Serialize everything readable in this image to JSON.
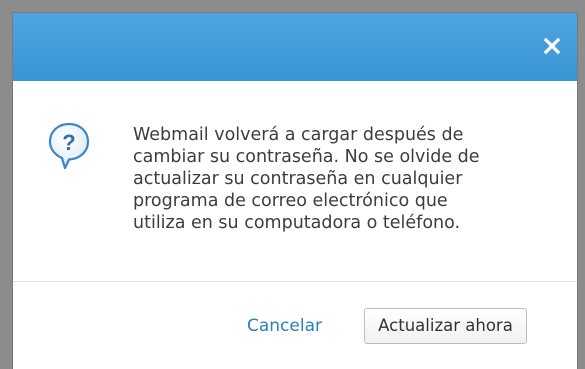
{
  "dialog": {
    "close_glyph": "x",
    "icon": "question-help-icon",
    "message_lines": [
      "Webmail volverá a cargar después de",
      "cambiar su contraseña. No se olvide de",
      "actualizar su contraseña en cualquier",
      "programa de correo electrónico que",
      "utiliza en su computadora o teléfono."
    ],
    "cancel_label": "Cancelar",
    "confirm_label": "Actualizar ahora"
  },
  "colors": {
    "titlebar": "#3a95d4",
    "link": "#2a7fc0",
    "icon_stroke": "#3a86c8"
  }
}
